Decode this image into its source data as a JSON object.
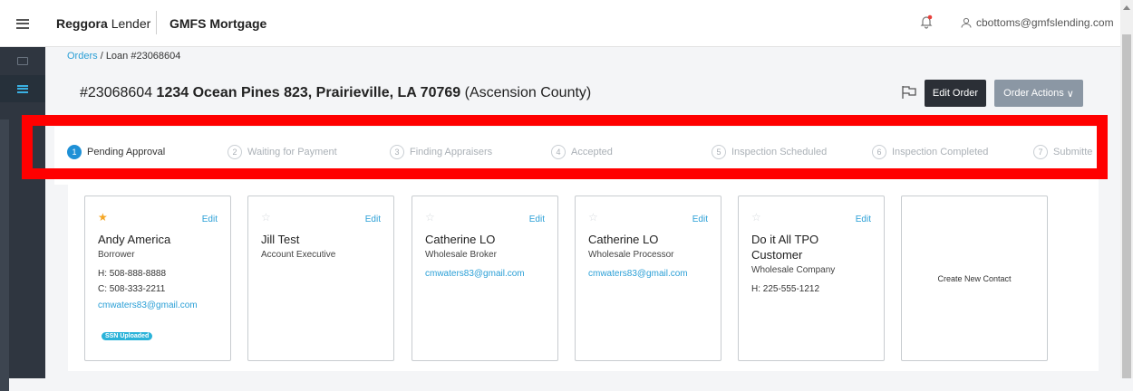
{
  "header": {
    "brand_name": "Reggora",
    "brand_suffix": "Lender",
    "company": "GMFS Mortgage",
    "user_email": "cbottoms@gmfslending.com"
  },
  "breadcrumb": {
    "root": "Orders",
    "separator": "/",
    "current": "Loan #23068604"
  },
  "order": {
    "loan_number": "#23068604",
    "address": "1234 Ocean Pines 823, Prairieville, LA 70769",
    "county": "(Ascension County)",
    "edit_label": "Edit Order",
    "actions_label": "Order Actions",
    "actions_caret": "∨"
  },
  "steps": [
    {
      "num": "1",
      "label": "Pending Approval"
    },
    {
      "num": "2",
      "label": "Waiting for Payment"
    },
    {
      "num": "3",
      "label": "Finding Appraisers"
    },
    {
      "num": "4",
      "label": "Accepted"
    },
    {
      "num": "5",
      "label": "Inspection Scheduled"
    },
    {
      "num": "6",
      "label": "Inspection Completed"
    },
    {
      "num": "7",
      "label": "Submitte"
    }
  ],
  "contacts": [
    {
      "name": "Andy America",
      "role": "Borrower",
      "home": "H: 508-888-8888",
      "cell": "C: 508-333-2211",
      "email": "cmwaters83@gmail.com",
      "badge": "SSN Uploaded",
      "edit": "Edit"
    },
    {
      "name": "Jill Test",
      "role": "Account Executive",
      "edit": "Edit"
    },
    {
      "name": "Catherine LO",
      "role": "Wholesale Broker",
      "email": "cmwaters83@gmail.com",
      "edit": "Edit"
    },
    {
      "name": "Catherine LO",
      "role": "Wholesale Processor",
      "email": "cmwaters83@gmail.com",
      "edit": "Edit"
    },
    {
      "name": "Do it All TPO Customer",
      "role": "Wholesale Company",
      "home": "H: 225-555-1212",
      "edit": "Edit"
    }
  ],
  "create_contact_label": "Create New Contact",
  "colors": {
    "accent": "#2a9fd6",
    "sidebar": "#2f3640",
    "highlight": "#ff0000",
    "star_filled": "#f5a623"
  }
}
